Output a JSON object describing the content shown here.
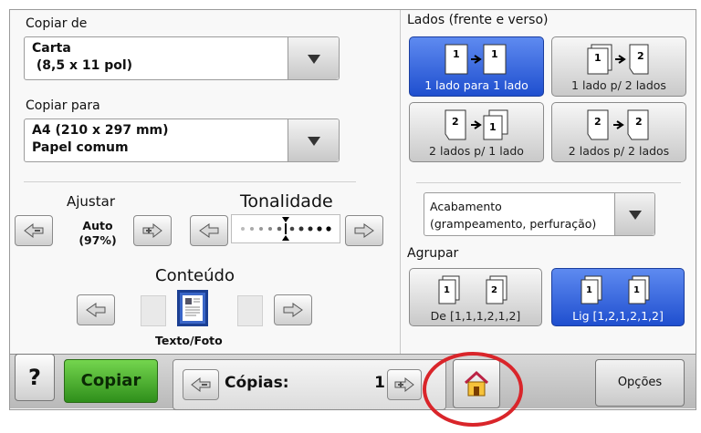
{
  "copy_from": {
    "label": "Copiar de",
    "value": "Carta\n (8,5 x 11 pol)"
  },
  "copy_to": {
    "label": "Copiar para",
    "value": "A4 (210 x 297 mm)\nPapel comum"
  },
  "scale": {
    "label": "Ajustar",
    "value": "Auto\n(97%)"
  },
  "darkness": {
    "label": "Tonalidade",
    "level": 0.5
  },
  "content": {
    "label": "Conteúdo",
    "selected": "Texto/Foto"
  },
  "sides": {
    "label": "Lados (frente e verso)",
    "options": [
      "1 lado para 1 lado",
      "1 lado p/ 2 lados",
      "2 lados p/ 1 lado",
      "2 lados p/ 2 lados"
    ],
    "selected_index": 0
  },
  "finishing": {
    "value": "Acabamento\n(grampeamento, perfuração)"
  },
  "collate": {
    "label": "Agrupar",
    "options": [
      "De [1,1,1,2,1,2]",
      "Lig [1,2,1,2,1,2]"
    ],
    "selected_index": 1
  },
  "bottom": {
    "help": "?",
    "copy_button": "Copiar",
    "copies_label": "Cópias:",
    "copies_value": "1",
    "options_button": "Opções"
  },
  "colors": {
    "accent": "#2f5fd0",
    "go": "#3fae28",
    "highlight_ring": "#d9252a"
  }
}
